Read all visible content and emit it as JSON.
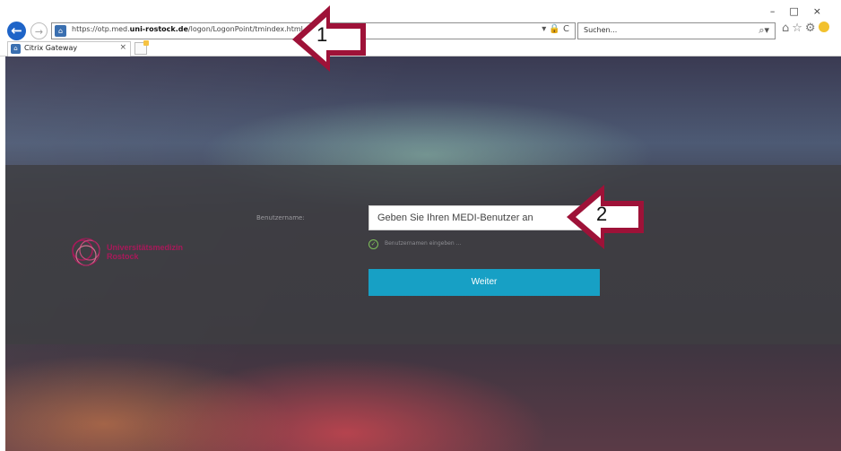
{
  "browser": {
    "url_prefix": "https://otp.med.",
    "url_host": "uni-rostock.de",
    "url_path": "/logon/LogonPoint/tmindex.html",
    "address_tools": "▾ 🔒 C",
    "search_placeholder": "Suchen...",
    "tab_title": "Citrix Gateway",
    "tab_close": "×",
    "window_controls": "–□×"
  },
  "login": {
    "username_label": "Benutzername:",
    "username_placeholder": "Geben Sie Ihren MEDI-Benutzer an",
    "hint": "Benutzernamen eingeben ...",
    "submit_label": "Weiter"
  },
  "logo": {
    "text": "Universitätsmedizin\nRostock"
  },
  "annotations": {
    "arrow1_label": "1",
    "arrow2_label": "2"
  },
  "colors": {
    "accent_button": "#17a0c5",
    "annotation_arrow": "#9e1238",
    "logo": "#a8195a"
  }
}
